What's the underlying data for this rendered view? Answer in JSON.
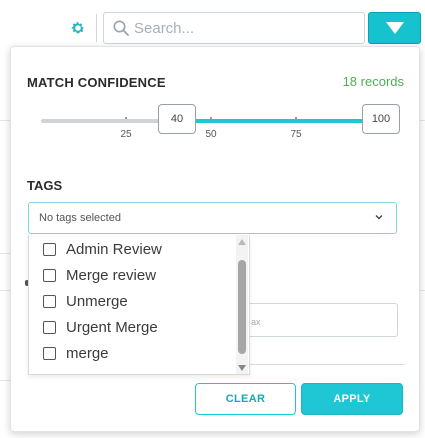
{
  "toolbar": {
    "search_placeholder": "Search...",
    "accent_color": "#17c2cf"
  },
  "filter_panel": {
    "match_confidence_label": "MATCH CONFIDENCE",
    "records_count": "18 records",
    "slider": {
      "min_value": "40",
      "max_value": "100",
      "scale_min": 0,
      "scale_max": 100,
      "ticks": [
        "25",
        "50",
        "75"
      ]
    },
    "tags_label": "TAGS",
    "tags_placeholder": "No tags selected",
    "tag_options": [
      {
        "label": "Admin Review",
        "checked": false
      },
      {
        "label": "Merge review",
        "checked": false
      },
      {
        "label": "Unmerge",
        "checked": false
      },
      {
        "label": "Urgent Merge",
        "checked": false
      },
      {
        "label": "merge",
        "checked": false
      }
    ],
    "obscured_input_fragment": "ax",
    "clear_label": "CLEAR",
    "apply_label": "APPLY"
  }
}
